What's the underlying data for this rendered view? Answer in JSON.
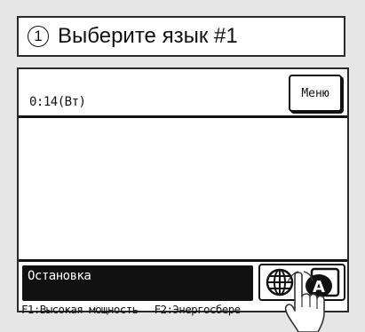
{
  "title": {
    "number": "1",
    "text": "Выберите язык #1"
  },
  "screen": {
    "clock": "0:14(Вт)",
    "menu_label": "Меню",
    "status": "Остановка"
  },
  "footer": {
    "f1": "F1:Высокая мощность",
    "f2": "F2:Энергосбере"
  },
  "icons": [
    "globe-icon",
    "language-a-icon",
    "pointing-hand-icon"
  ]
}
